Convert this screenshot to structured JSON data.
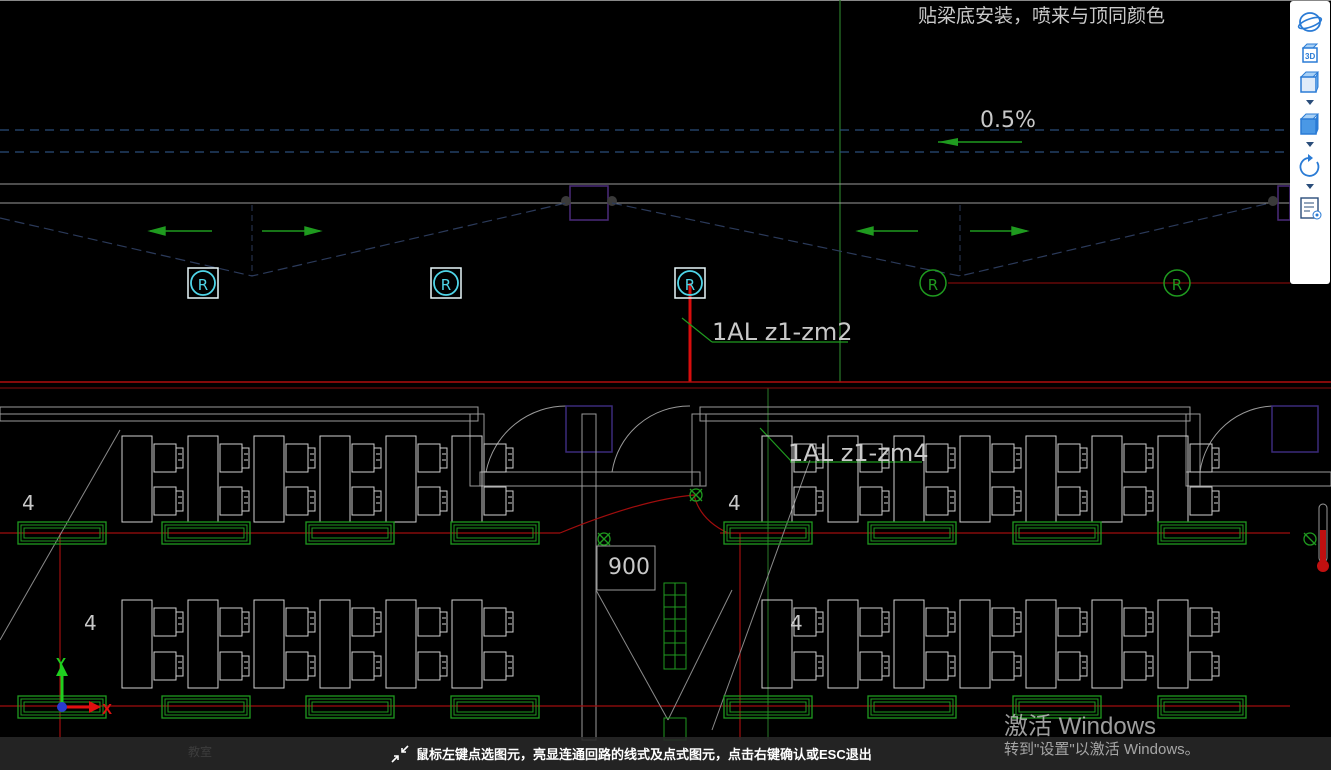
{
  "drawing": {
    "note_text": "贴梁底安装，喷来与顶同颜色",
    "slope_label": "0.5%",
    "circuit_label_1": "1AL z1-zm2",
    "circuit_label_2": "1AL z1-zm4",
    "dimension_900": "900",
    "room_label": "教室",
    "count_labels": [
      "4",
      "4",
      "4",
      "4"
    ],
    "junction_symbol": "R"
  },
  "axis": {
    "x_label": "X",
    "y_label": "Y"
  },
  "view_toolbar": {
    "items": [
      "orbit-icon",
      "3d-view-icon",
      "box-view-icon",
      "box-view-alt-icon",
      "rotate-icon",
      "layer-settings-icon"
    ]
  },
  "status": {
    "message": "鼠标左键点选图元，亮显连通回路的线式及点式图元，点击右键确认或ESC退出"
  },
  "watermark": {
    "title": "激活 Windows",
    "subtitle": "转到\"设置\"以激活 Windows。"
  },
  "colors": {
    "background": "#000000",
    "highlight_red": "#e01010",
    "selection_cyan": "#4fd5e8",
    "furniture_white": "#d8d8d8",
    "fixture_green": "#1f9a1f"
  }
}
